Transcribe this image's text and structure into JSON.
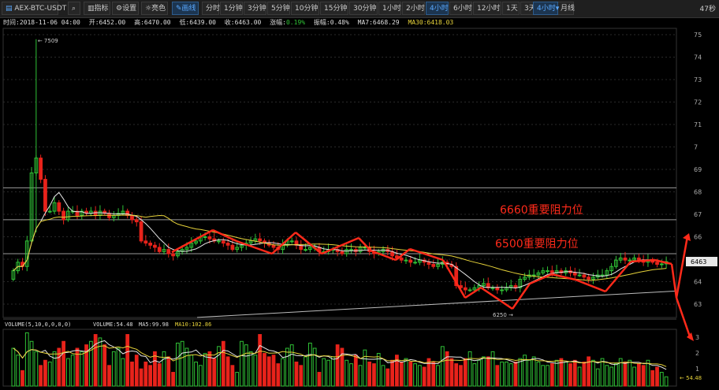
{
  "toolbar": {
    "symbol": "AEX-BTC-USDT",
    "buttons": [
      {
        "label": "指标",
        "icon": "chart-icon"
      },
      {
        "label": "设置",
        "icon": "gear-icon"
      },
      {
        "label": "亮色",
        "icon": "sun-icon"
      },
      {
        "label": "画线",
        "icon": "pencil-icon",
        "active": true
      }
    ],
    "periods": [
      "分时",
      "1分钟",
      "3分钟",
      "5分钟",
      "10分钟",
      "15分钟",
      "30分钟",
      "1小时",
      "2小时",
      "4小时",
      "6小时",
      "12小时",
      "1天",
      "3天",
      "周线",
      "月线"
    ],
    "active_period": "4小时",
    "period_dropdown": "4小时",
    "countdown": "47秒"
  },
  "info": {
    "time": "时间:2018-11-06 04:00",
    "open": "开:6452.00",
    "high": "高:6470.00",
    "low": "低:6439.00",
    "close": "收:6463.00",
    "change_label": "涨幅:",
    "change_value": "0.19%",
    "amplitude": "振幅:0.48%",
    "ma7": "MA7:6468.29",
    "ma30": "MA30:6418.03"
  },
  "volume_info": {
    "params": "VOLUME(5,10,0,0,0,0)",
    "volume": "VOLUME:54.48",
    "ma5": "MA5:99.98",
    "ma10": "MA10:102.86"
  },
  "colors": {
    "up": "#30c236",
    "down": "#e8231b",
    "ma7": "#e6e6e6",
    "ma30": "#e6d23a",
    "grid": "#2a2a2a",
    "annotation": "#ff2a1a",
    "level": "#9a9a9a"
  },
  "chart_data": {
    "type": "candlestick",
    "price_axis_ticks": [
      "75",
      "74",
      "73",
      "72",
      "71",
      "7",
      "69",
      "68",
      "67",
      "66",
      "65",
      "64",
      "63"
    ],
    "volume_axis_ticks": [
      "3",
      "2",
      "1"
    ],
    "ylim": [
      6250,
      7509
    ],
    "current_price": "6463",
    "max_label": "7509",
    "min_label": "6250",
    "volume_current_label": "54.48",
    "annotations": [
      {
        "text": "6660重要阻力位",
        "price": 6660
      },
      {
        "text": "6500重要阻力位",
        "price": 6500
      }
    ],
    "horizontal_levels": [
      6810,
      6660,
      6500
    ],
    "trendline_support": [
      6245,
      6310
    ],
    "candles": {
      "open": [
        6380,
        6420,
        6460,
        6440,
        6560,
        6880,
        6950,
        6850,
        6700,
        6700,
        6740,
        6700,
        6660,
        6700,
        6700,
        6680,
        6700,
        6690,
        6700,
        6680,
        6700,
        6690,
        6670,
        6680,
        6690,
        6700,
        6680,
        6660,
        6650,
        6560,
        6550,
        6540,
        6530,
        6510,
        6520,
        6500,
        6490,
        6510,
        6520,
        6530,
        6550,
        6560,
        6580,
        6580,
        6570,
        6560,
        6560,
        6550,
        6540,
        6520,
        6530,
        6540,
        6550,
        6560,
        6570,
        6560,
        6550,
        6540,
        6530,
        6520,
        6540,
        6560,
        6560,
        6540,
        6520,
        6520,
        6530,
        6530,
        6510,
        6510,
        6520,
        6520,
        6510,
        6500,
        6520,
        6520,
        6510,
        6530,
        6530,
        6510,
        6500,
        6510,
        6520,
        6510,
        6490,
        6480,
        6470,
        6470,
        6460,
        6460,
        6470,
        6460,
        6450,
        6440,
        6450,
        6460,
        6450,
        6440,
        6350,
        6340,
        6330,
        6330,
        6340,
        6350,
        6360,
        6340,
        6340,
        6330,
        6330,
        6340,
        6350,
        6340,
        6380,
        6390,
        6400,
        6400,
        6410,
        6420,
        6420,
        6410,
        6420,
        6410,
        6420,
        6410,
        6400,
        6400,
        6390,
        6380,
        6390,
        6400,
        6400,
        6420,
        6440,
        6470,
        6480,
        6470,
        6470,
        6480,
        6470,
        6460,
        6470,
        6460,
        6450,
        6452
      ],
      "close": [
        6420,
        6460,
        6440,
        6560,
        6880,
        6950,
        6850,
        6700,
        6700,
        6740,
        6700,
        6660,
        6700,
        6700,
        6680,
        6700,
        6690,
        6700,
        6680,
        6700,
        6690,
        6670,
        6680,
        6690,
        6700,
        6680,
        6660,
        6650,
        6560,
        6550,
        6540,
        6530,
        6510,
        6520,
        6500,
        6490,
        6510,
        6520,
        6530,
        6550,
        6560,
        6580,
        6580,
        6570,
        6560,
        6560,
        6550,
        6540,
        6520,
        6530,
        6540,
        6550,
        6560,
        6570,
        6560,
        6550,
        6540,
        6530,
        6520,
        6540,
        6560,
        6560,
        6540,
        6520,
        6520,
        6530,
        6530,
        6510,
        6510,
        6520,
        6520,
        6510,
        6500,
        6520,
        6520,
        6510,
        6530,
        6530,
        6510,
        6500,
        6510,
        6520,
        6510,
        6490,
        6480,
        6470,
        6470,
        6460,
        6460,
        6470,
        6460,
        6450,
        6440,
        6450,
        6460,
        6450,
        6440,
        6350,
        6340,
        6330,
        6330,
        6340,
        6350,
        6360,
        6340,
        6340,
        6330,
        6330,
        6340,
        6350,
        6340,
        6380,
        6390,
        6400,
        6400,
        6410,
        6420,
        6420,
        6410,
        6420,
        6410,
        6420,
        6410,
        6400,
        6400,
        6390,
        6380,
        6390,
        6400,
        6400,
        6420,
        6440,
        6470,
        6480,
        6470,
        6470,
        6480,
        6470,
        6460,
        6470,
        6460,
        6450,
        6452,
        6463
      ]
    },
    "volume": [
      220,
      180,
      90,
      310,
      260,
      200,
      120,
      150,
      140,
      200,
      220,
      260,
      160,
      180,
      220,
      200,
      240,
      260,
      300,
      280,
      240,
      120,
      200,
      220,
      160,
      300,
      140,
      180,
      100,
      140,
      120,
      200,
      130,
      200,
      170,
      80,
      250,
      260,
      220,
      180,
      140,
      120,
      190,
      200,
      160,
      230,
      260,
      170,
      120,
      80,
      260,
      240,
      200,
      180,
      300,
      190,
      170,
      180,
      130,
      160,
      220,
      240,
      140,
      120,
      170,
      250,
      220,
      80,
      160,
      150,
      170,
      240,
      220,
      150,
      130,
      180,
      120,
      210,
      140,
      130,
      190,
      120,
      100,
      150,
      180,
      140,
      160,
      140,
      130,
      120,
      110,
      160,
      140,
      120,
      230,
      200,
      160,
      130,
      120,
      160,
      200,
      130,
      150,
      170,
      170,
      200,
      120,
      140,
      140,
      130,
      140,
      160,
      180,
      150,
      170,
      140,
      120,
      120,
      130,
      150,
      160,
      140,
      130,
      150,
      110,
      140,
      170,
      150,
      100,
      160,
      120,
      110,
      130,
      160,
      140,
      150,
      110,
      130,
      120,
      150,
      90,
      110,
      80,
      54
    ]
  }
}
